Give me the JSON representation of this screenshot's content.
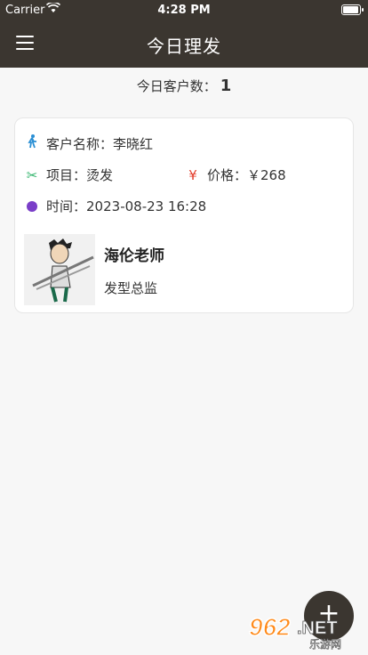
{
  "status_bar": {
    "carrier": "Carrier",
    "time": "4:28 PM"
  },
  "header": {
    "title": "今日理发"
  },
  "summary": {
    "label": "今日客户数：",
    "value": "1"
  },
  "card": {
    "customer_label": "客户名称：",
    "customer_name": "李晓红",
    "service_label": "项目：",
    "service": "烫发",
    "price_label": "价格：",
    "price": "￥268",
    "time_label": "时间：",
    "time": "2023-08-23 16:28",
    "stylist_name": "海伦老师",
    "stylist_role": "发型总监"
  },
  "icons": {
    "menu": "menu-icon",
    "customer": "person-walking-icon",
    "service": "scissors-icon",
    "price": "yen-icon",
    "time": "timer-icon",
    "add": "plus-icon"
  },
  "fab": {
    "label": "+"
  },
  "watermark": {
    "text": "962.NET",
    "subtext": "乐游网"
  },
  "colors": {
    "header_bg": "#3b3630",
    "scissors": "#2fb36a",
    "yen": "#e33c2a",
    "timer": "#7a3ec8",
    "walk": "#2a8fd4"
  }
}
